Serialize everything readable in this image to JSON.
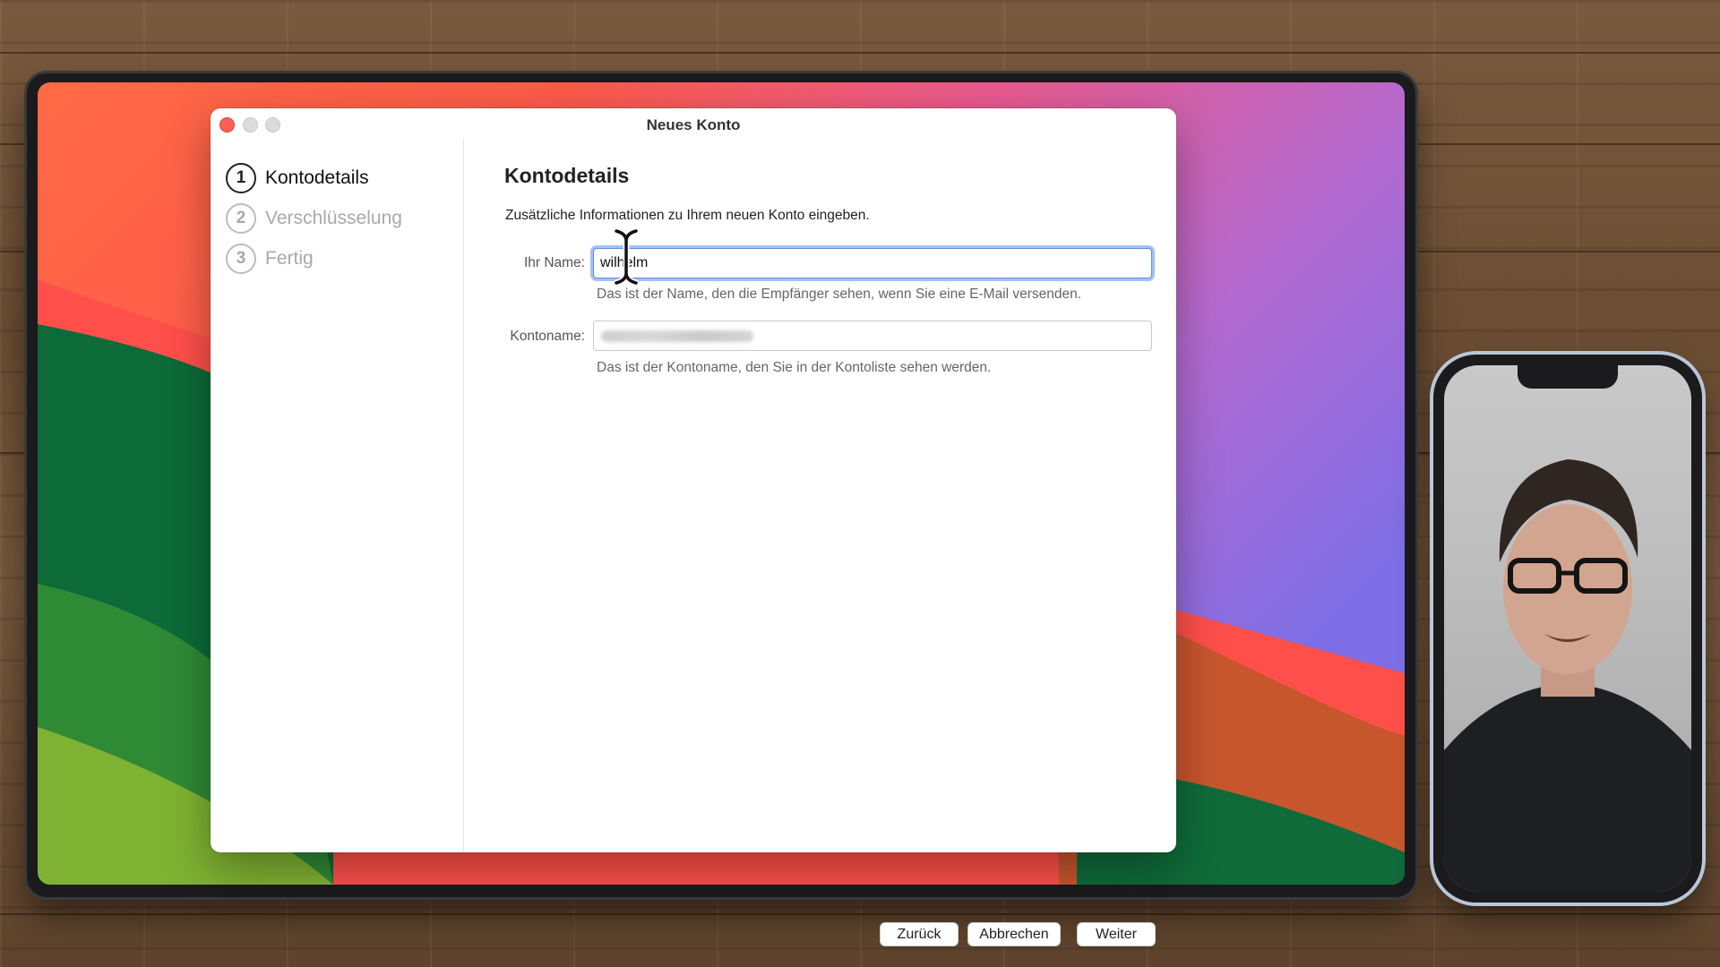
{
  "window": {
    "title": "Neues Konto"
  },
  "steps": [
    {
      "number": "1",
      "label": "Kontodetails",
      "active": true
    },
    {
      "number": "2",
      "label": "Verschlüsselung",
      "active": false
    },
    {
      "number": "3",
      "label": "Fertig",
      "active": false
    }
  ],
  "content": {
    "heading": "Kontodetails",
    "intro": "Zusätzliche Informationen zu Ihrem neuen Konto eingeben.",
    "name_field": {
      "label": "Ihr Name:",
      "value": "wilhelm",
      "hint": "Das ist der Name, den die Empfänger sehen, wenn Sie eine E-Mail versenden."
    },
    "account_field": {
      "label": "Kontoname:",
      "hint": "Das ist der Kontoname, den Sie in der Kontoliste sehen werden."
    }
  },
  "buttons": {
    "back": "Zurück",
    "cancel": "Abbrechen",
    "next": "Weiter"
  },
  "colors": {
    "focus_ring": "#5a8ee6",
    "close_button": "#fe5f57"
  },
  "icons": {
    "cursor": "text-cursor-icon"
  }
}
